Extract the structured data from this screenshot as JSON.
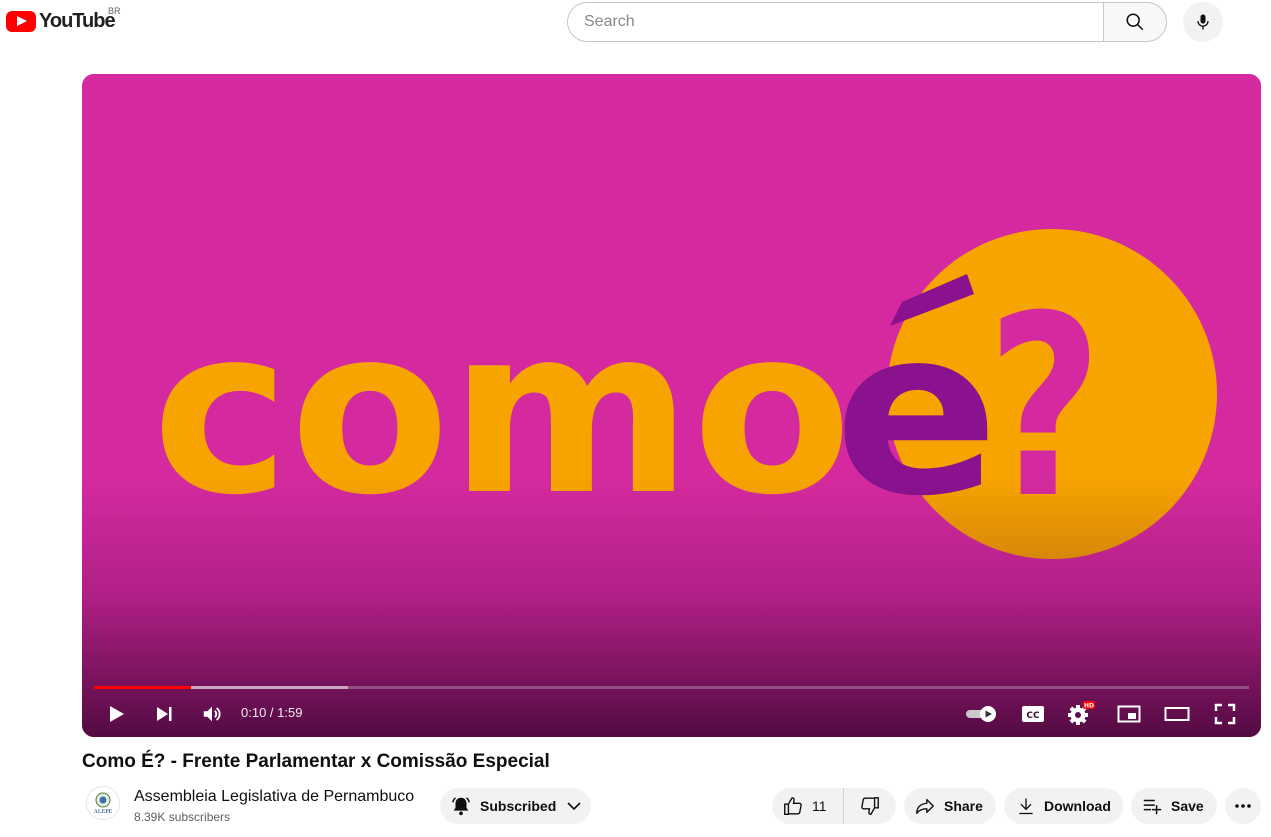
{
  "header": {
    "logo_text": "YouTube",
    "country_code": "BR",
    "search_placeholder": "Search",
    "icons": [
      "youtube-logo-icon",
      "search-icon",
      "mic-icon"
    ]
  },
  "player": {
    "artwork_text": "comoé?",
    "time_display": "0:10 / 1:59",
    "progress_played_fraction": 0.084,
    "progress_buffered_fraction": 0.22,
    "autoplay_on": true,
    "hd_badge": "HD",
    "colors": {
      "background": "#d52a9f",
      "orange": "#f7a400",
      "purple": "#8a128f",
      "played": "#ff0000"
    }
  },
  "video": {
    "title": "Como É? - Frente Parlamentar x Comissão Especial"
  },
  "channel": {
    "name": "Assembleia Legislativa de Pernambuco",
    "subscribers": "8.39K subscribers",
    "avatar_text": "ALEPE"
  },
  "actions": {
    "subscribe_label": "Subscribed",
    "like_count": "11",
    "share_label": "Share",
    "download_label": "Download",
    "save_label": "Save"
  }
}
